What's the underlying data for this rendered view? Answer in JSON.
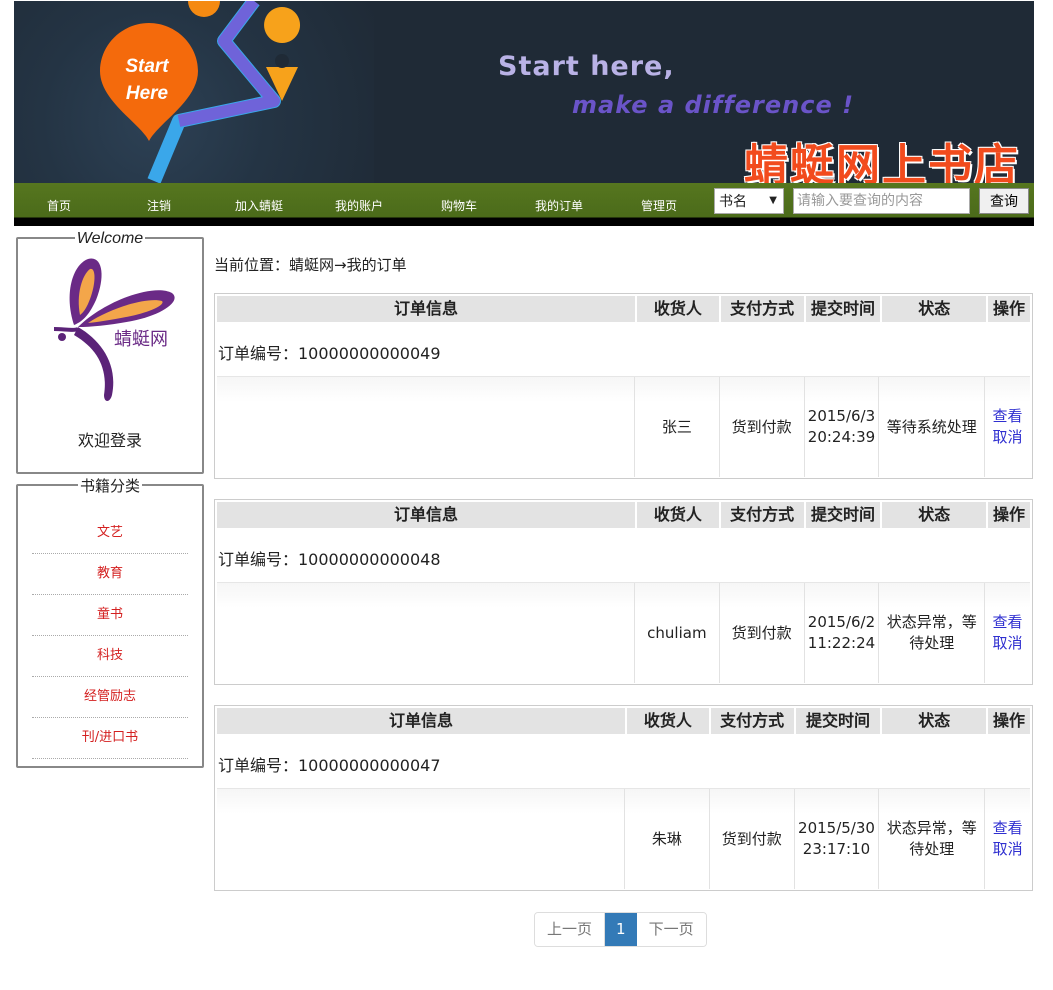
{
  "banner": {
    "start_line1": "Start",
    "start_line2": "Here",
    "slogan_line1": "Start here,",
    "slogan_line2": "make a difference !",
    "shop_name": "蜻蜓网上书店"
  },
  "nav": {
    "items": [
      "首页",
      "注销",
      "加入蜻蜓",
      "我的账户",
      "购物车",
      "我的订单",
      "管理页"
    ],
    "search_type": "书名",
    "search_placeholder": "请输入要查询的内容",
    "search_button": "查询"
  },
  "sidebar": {
    "welcome_legend": "Welcome",
    "logo_text": "蜻蜓网",
    "welcome_text": "欢迎登录",
    "category_legend": "书籍分类",
    "categories": [
      "文艺",
      "教育",
      "童书",
      "科技",
      "经管励志",
      "刊/进口书"
    ]
  },
  "breadcrumb": "当前位置：蜻蜓网→我的订单",
  "table_headers": {
    "info": "订单信息",
    "receiver": "收货人",
    "payment": "支付方式",
    "time": "提交时间",
    "status": "状态",
    "action": "操作"
  },
  "orders": [
    {
      "number_label": "订单编号：10000000000049",
      "receiver": "张三",
      "payment": "货到付款",
      "time": "2015/6/3 20:24:39",
      "status": "等待系统处理",
      "view": "查看",
      "cancel": "取消"
    },
    {
      "number_label": "订单编号：10000000000048",
      "receiver": "chuliam",
      "payment": "货到付款",
      "time": "2015/6/2 11:22:24",
      "status": "状态异常，等待处理",
      "view": "查看",
      "cancel": "取消"
    },
    {
      "number_label": "订单编号：10000000000047",
      "receiver": "朱琳",
      "payment": "货到付款",
      "time": "2015/5/30 23:17:10",
      "status": "状态异常，等待处理",
      "view": "查看",
      "cancel": "取消"
    }
  ],
  "pagination": {
    "prev": "上一页",
    "current": "1",
    "next": "下一页"
  },
  "colors": {
    "nav_green": "#4b6b1a",
    "category_red": "#d42020",
    "link_blue": "#2f2fd0",
    "pager_active": "#337ab7"
  }
}
